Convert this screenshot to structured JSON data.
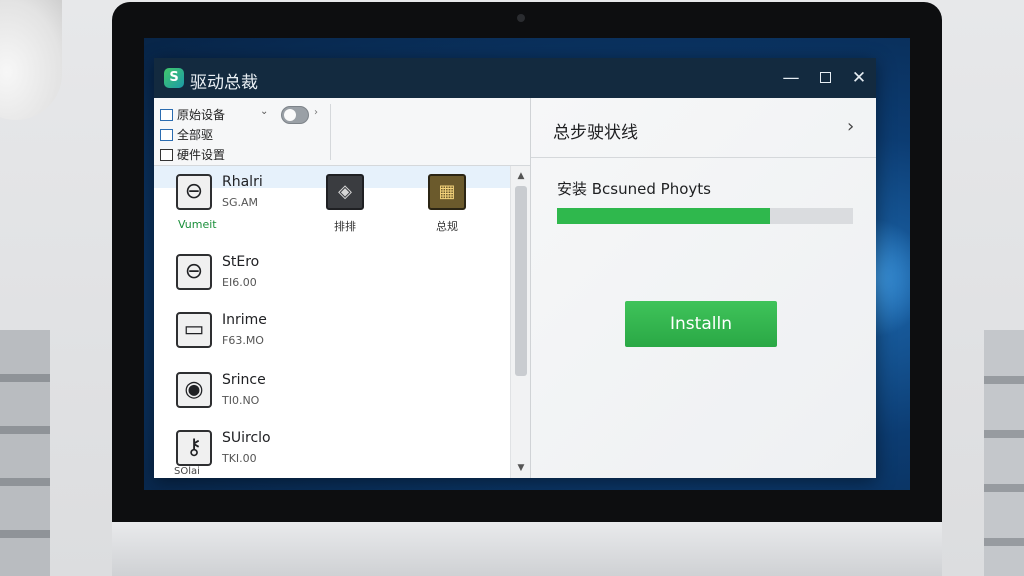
{
  "window": {
    "app_logo": "S",
    "title": "驱动总裁",
    "minimize_label": "—",
    "close_label": "✕"
  },
  "toolbar": {
    "items": [
      {
        "label": "原始设备"
      },
      {
        "label": "全部驱"
      },
      {
        "label": "硬件设置"
      }
    ],
    "dropdown_caret": "⌄",
    "toggle_on": true,
    "chevron": "›"
  },
  "devices": [
    {
      "name": "Rhalri",
      "sub": "SG.AM",
      "status": "Vumeit",
      "icon": "⊖"
    },
    {
      "name": "StEro",
      "sub": "EI6.00",
      "icon": "⊖"
    },
    {
      "name": "Inrime",
      "sub": "F63.MO",
      "icon": "▭"
    },
    {
      "name": "Srince",
      "sub": "TI0.NO",
      "icon": "◉"
    },
    {
      "name": "SUirclo",
      "sub": "TKI.00",
      "icon": "⚷"
    }
  ],
  "chips": [
    {
      "label": "排排",
      "icon": "◈"
    },
    {
      "label": "总规",
      "icon": "▦"
    }
  ],
  "list_cutoff": "SOlai",
  "scroll": {
    "up": "▲",
    "down": "▼"
  },
  "right_panel": {
    "title": "总步驶状线",
    "chevron": "›",
    "progress_label": "安装  Bcsuned Phoyts",
    "progress": 0.72,
    "install_label": "Installn"
  },
  "colors": {
    "titlebar": "#132a3f",
    "accent_green": "#2fb84d",
    "desktop_blue": "#0c3c72"
  }
}
